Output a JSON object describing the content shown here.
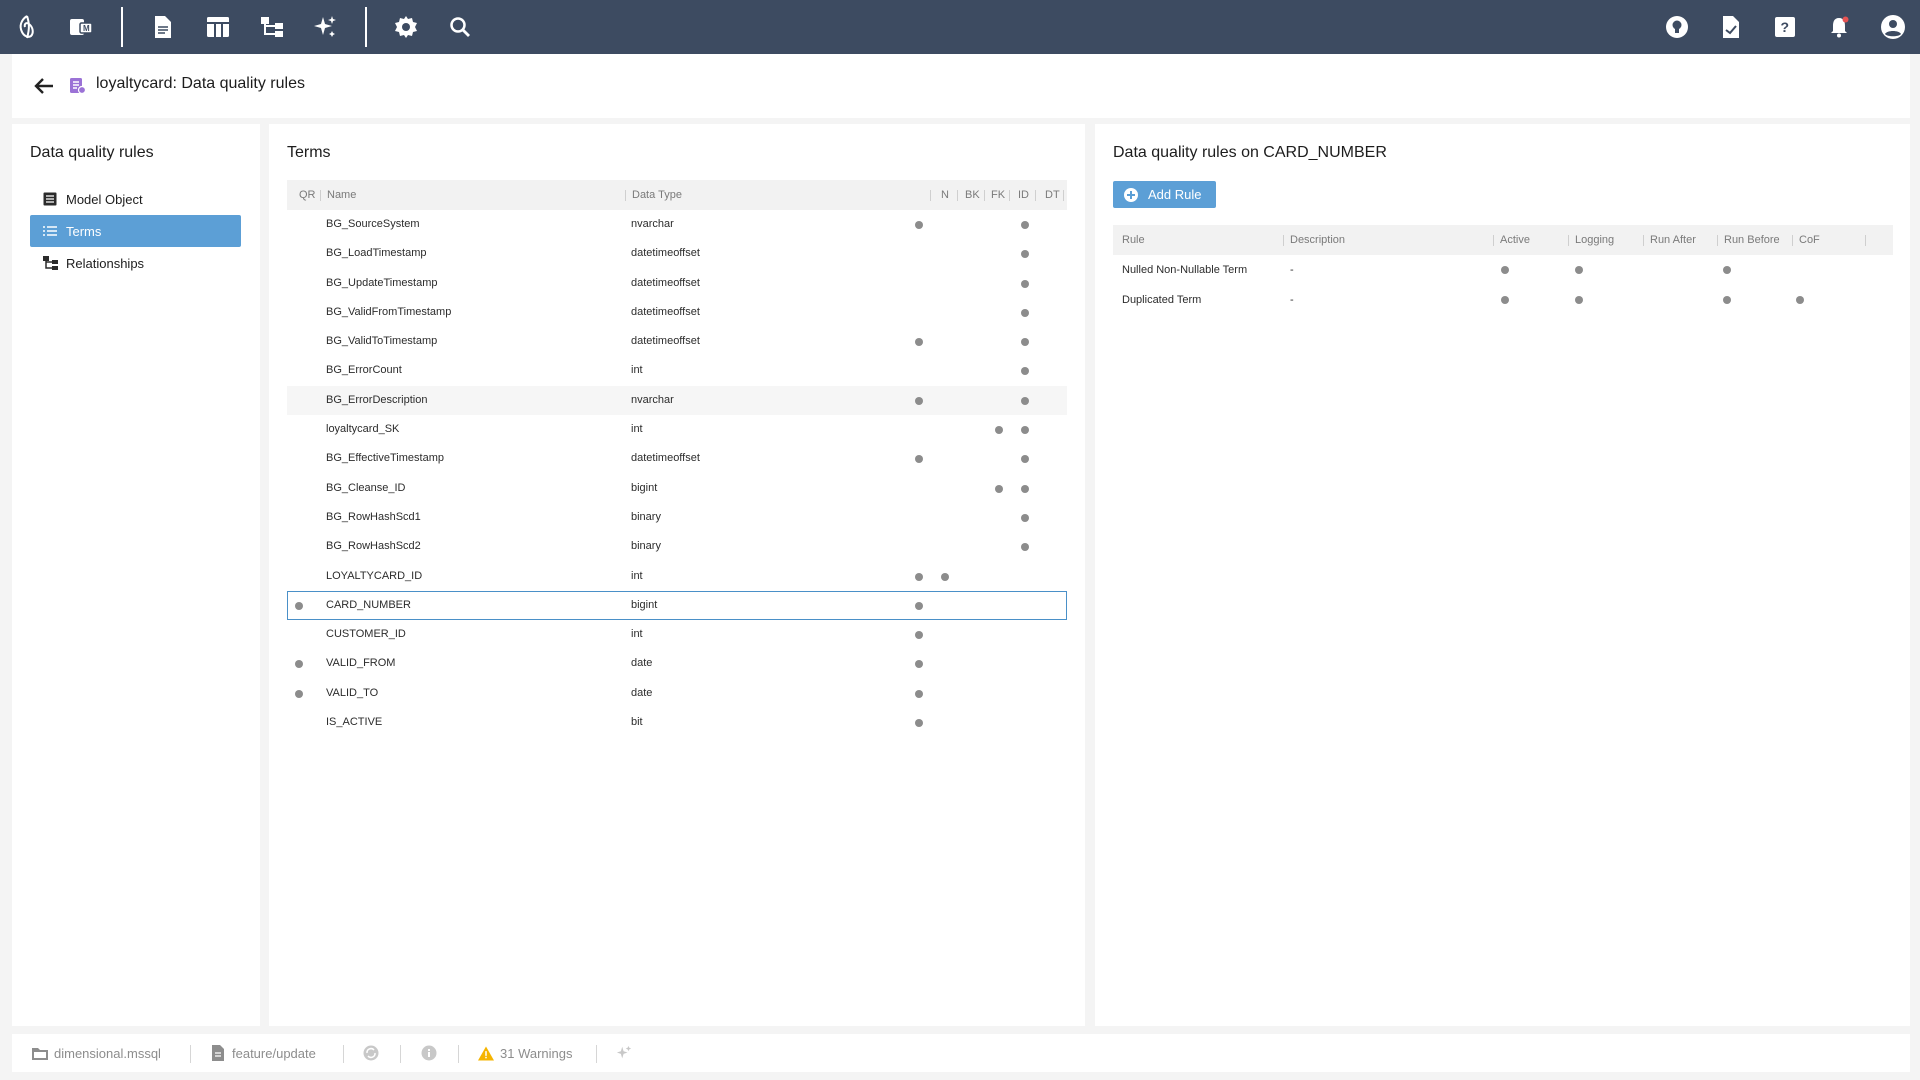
{
  "topbar": {
    "left_icons": [
      "logo-icon",
      "model-icon",
      "document-icon",
      "table-icon",
      "hierarchy-icon",
      "sparkle-icon",
      "settings-icon",
      "search-icon"
    ],
    "right_icons": [
      "lightbulb-icon",
      "file-check-icon",
      "help-icon",
      "notification-bell-icon",
      "account-icon"
    ],
    "background": "#3d4b61"
  },
  "titlebar": {
    "title": "loyaltycard: Data quality rules"
  },
  "left_panel": {
    "title": "Data quality rules",
    "items": [
      {
        "label": "Model Object",
        "icon": "list-box-icon",
        "active": false
      },
      {
        "label": "Terms",
        "icon": "list-icon",
        "active": true
      },
      {
        "label": "Relationships",
        "icon": "hierarchy-icon",
        "active": false
      }
    ]
  },
  "terms_panel": {
    "title": "Terms",
    "columns": [
      "QR",
      "Name",
      "Data Type",
      "N",
      "BK",
      "FK",
      "ID",
      "DT"
    ],
    "rows": [
      {
        "qr": false,
        "name": "BG_SourceSystem",
        "type": "nvarchar",
        "n": true,
        "bk": false,
        "fk": false,
        "id": false,
        "dt": true
      },
      {
        "qr": false,
        "name": "BG_LoadTimestamp",
        "type": "datetimeoffset",
        "n": false,
        "bk": false,
        "fk": false,
        "id": false,
        "dt": true
      },
      {
        "qr": false,
        "name": "BG_UpdateTimestamp",
        "type": "datetimeoffset",
        "n": false,
        "bk": false,
        "fk": false,
        "id": false,
        "dt": true
      },
      {
        "qr": false,
        "name": "BG_ValidFromTimestamp",
        "type": "datetimeoffset",
        "n": false,
        "bk": false,
        "fk": false,
        "id": false,
        "dt": true
      },
      {
        "qr": false,
        "name": "BG_ValidToTimestamp",
        "type": "datetimeoffset",
        "n": true,
        "bk": false,
        "fk": false,
        "id": false,
        "dt": true
      },
      {
        "qr": false,
        "name": "BG_ErrorCount",
        "type": "int",
        "n": false,
        "bk": false,
        "fk": false,
        "id": false,
        "dt": true
      },
      {
        "qr": false,
        "name": "BG_ErrorDescription",
        "type": "nvarchar",
        "n": true,
        "bk": false,
        "fk": false,
        "id": false,
        "dt": true
      },
      {
        "qr": false,
        "name": "loyaltycard_SK",
        "type": "int",
        "n": false,
        "bk": false,
        "fk": false,
        "id": true,
        "dt": true
      },
      {
        "qr": false,
        "name": "BG_EffectiveTimestamp",
        "type": "datetimeoffset",
        "n": true,
        "bk": false,
        "fk": false,
        "id": false,
        "dt": true
      },
      {
        "qr": false,
        "name": "BG_Cleanse_ID",
        "type": "bigint",
        "n": false,
        "bk": false,
        "fk": false,
        "id": true,
        "dt": true
      },
      {
        "qr": false,
        "name": "BG_RowHashScd1",
        "type": "binary",
        "n": false,
        "bk": false,
        "fk": false,
        "id": false,
        "dt": true
      },
      {
        "qr": false,
        "name": "BG_RowHashScd2",
        "type": "binary",
        "n": false,
        "bk": false,
        "fk": false,
        "id": false,
        "dt": true
      },
      {
        "qr": false,
        "name": "LOYALTYCARD_ID",
        "type": "int",
        "n": true,
        "bk": true,
        "fk": false,
        "id": false,
        "dt": false
      },
      {
        "qr": true,
        "name": "CARD_NUMBER",
        "type": "bigint",
        "n": true,
        "bk": false,
        "fk": false,
        "id": false,
        "dt": false,
        "selected": true
      },
      {
        "qr": false,
        "name": "CUSTOMER_ID",
        "type": "int",
        "n": true,
        "bk": false,
        "fk": false,
        "id": false,
        "dt": false
      },
      {
        "qr": true,
        "name": "VALID_FROM",
        "type": "date",
        "n": true,
        "bk": false,
        "fk": false,
        "id": false,
        "dt": false
      },
      {
        "qr": true,
        "name": "VALID_TO",
        "type": "date",
        "n": true,
        "bk": false,
        "fk": false,
        "id": false,
        "dt": false
      },
      {
        "qr": false,
        "name": "IS_ACTIVE",
        "type": "bit",
        "n": true,
        "bk": false,
        "fk": false,
        "id": false,
        "dt": false
      }
    ]
  },
  "rules_panel": {
    "title": "Data quality rules on CARD_NUMBER",
    "add_button": "Add Rule",
    "columns": [
      "Rule",
      "Description",
      "Active",
      "Logging",
      "Run After",
      "Run Before",
      "CoF"
    ],
    "rows": [
      {
        "rule": "Nulled Non-Nullable Term",
        "description": "-",
        "active": true,
        "logging": true,
        "run_after": false,
        "run_before": true,
        "cof": false
      },
      {
        "rule": "Duplicated Term",
        "description": "-",
        "active": true,
        "logging": true,
        "run_after": false,
        "run_before": true,
        "cof": true
      }
    ]
  },
  "statusbar": {
    "model": "dimensional.mssql",
    "branch": "feature/update",
    "warnings": "31 Warnings"
  },
  "colors": {
    "accent": "#5c9fd6",
    "selection_border": "#4a90c8",
    "warning": "#f5b400"
  }
}
